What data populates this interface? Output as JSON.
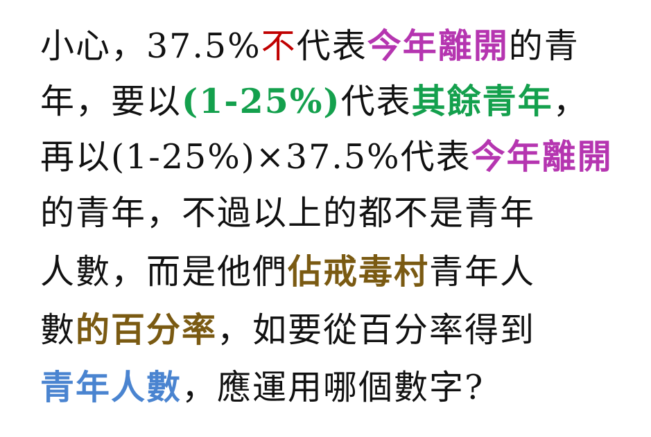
{
  "text": {
    "line1": {
      "a": "小心，37.5%",
      "b": "不",
      "c": "代表",
      "d": "今年離開",
      "e": "的青"
    },
    "line2": {
      "a": "年，要以",
      "b": "(1-25%)",
      "c": "代表",
      "d": "其餘青年",
      "e": "，"
    },
    "line3": {
      "a": "再以(1-25%)×37.5%代表",
      "b": "今年離開"
    },
    "line4": {
      "a": "的青年，不過以上的都不是青年"
    },
    "line5": {
      "a": "人數，而是他們",
      "b": "佔戒毒村",
      "c": "青年人"
    },
    "line6": {
      "a": "數",
      "b": "的百分率",
      "c": "，如要從百分率得到"
    },
    "line7": {
      "a": "青年人數",
      "b": "，應運用哪個數字?"
    }
  },
  "colors": {
    "text": "#111111",
    "red": "#c00000",
    "purple": "#b535b0",
    "green": "#14a04d",
    "olive": "#7a5a12",
    "blue": "#4a84d0",
    "background": "#ffffff"
  }
}
